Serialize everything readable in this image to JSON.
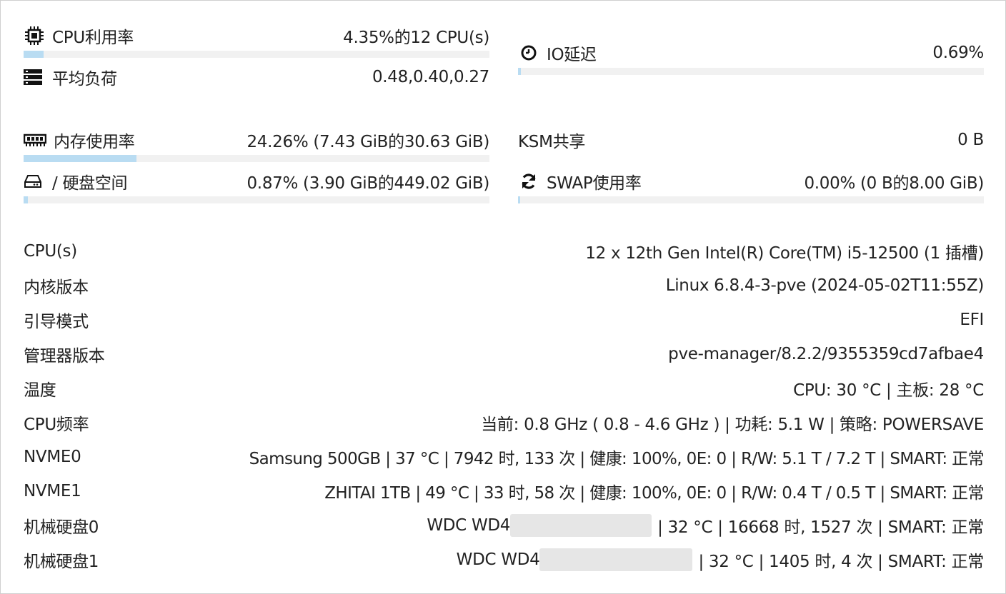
{
  "left": {
    "cpu": {
      "label": "CPU利用率",
      "value": "4.35%的12 CPU(s)",
      "percent": 4.35,
      "icon": "cpu-chip-icon"
    },
    "load": {
      "label": "平均负荷",
      "value": "0.48,0.40,0.27",
      "icon": "server-stack-icon"
    },
    "memory": {
      "label": "内存使用率",
      "value": "24.26% (7.43 GiB的30.63 GiB)",
      "percent": 24.26,
      "icon": "memory-module-icon"
    },
    "disk": {
      "label": "/ 硬盘空间",
      "value": "0.87% (3.90 GiB的449.02 GiB)",
      "percent": 0.87,
      "icon": "hard-drive-icon"
    }
  },
  "right": {
    "io": {
      "label": "IO延迟",
      "value": "0.69%",
      "percent": 0.69,
      "icon": "clock-icon"
    },
    "ksm": {
      "label": "KSM共享",
      "value": "0 B"
    },
    "swap": {
      "label": "SWAP使用率",
      "value": "0.00% (0 B的8.00 GiB)",
      "percent": 0.0,
      "icon": "refresh-icon"
    }
  },
  "info": [
    {
      "label": "CPU(s)",
      "value": "12 x 12th Gen Intel(R) Core(TM) i5-12500 (1 插槽)"
    },
    {
      "label": "内核版本",
      "value": "Linux 6.8.4-3-pve (2024-05-02T11:55Z)"
    },
    {
      "label": "引导模式",
      "value": "EFI"
    },
    {
      "label": "管理器版本",
      "value": "pve-manager/8.2.2/9355359cd7afbae4"
    },
    {
      "label": "温度",
      "value": "CPU: 30 °C | 主板: 28 °C"
    },
    {
      "label": "CPU频率",
      "value": "当前: 0.8 GHz ( 0.8 - 4.6 GHz ) | 功耗: 5.1 W | 策略: POWERSAVE"
    },
    {
      "label": "NVME0",
      "value": "Samsung 500GB | 37 °C | 7942 时, 133 次 | 健康: 100%, 0E: 0 | R/W: 5.1 T / 7.2 T | SMART: 正常"
    },
    {
      "label": "NVME1",
      "value": "ZHITAI 1TB | 49 °C | 33 时, 58 次 | 健康: 100%, 0E: 0 | R/W: 0.4 T / 0.5 T | SMART: 正常"
    },
    {
      "label": "机械硬盘0",
      "value_prefix": "WDC WD4",
      "value_suffix": "| 32 °C | 16668 时, 1527 次 | SMART: 正常"
    },
    {
      "label": "机械硬盘1",
      "value_prefix": "WDC WD4",
      "value_suffix": "| 32 °C | 1405 时, 4 次 | SMART: 正常"
    }
  ],
  "colors": {
    "bar_fill": "#b9dcf2",
    "bar_track": "#f1f1f1",
    "text": "#222222"
  }
}
